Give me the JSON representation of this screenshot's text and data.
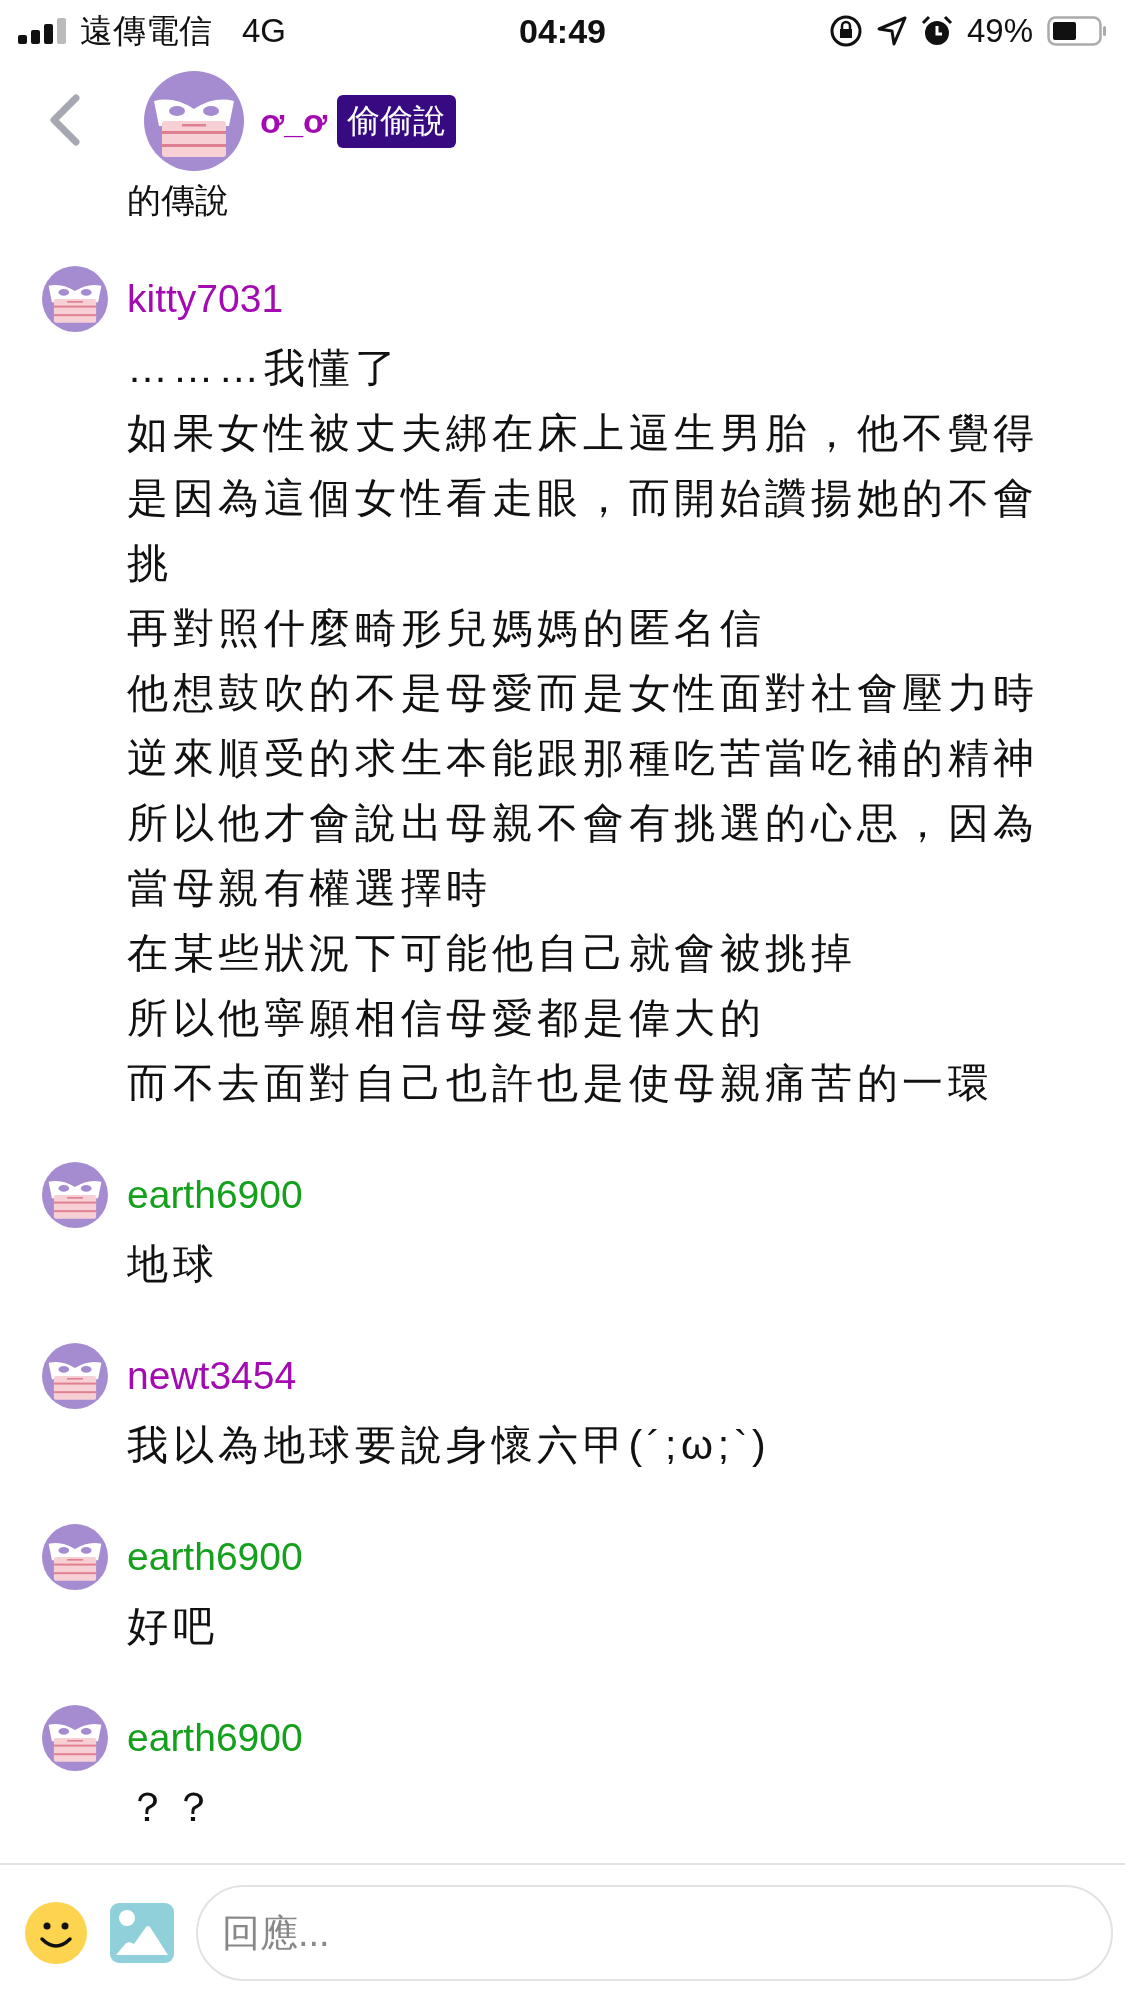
{
  "status_bar": {
    "carrier": "遠傳電信",
    "network": "4G",
    "time": "04:49",
    "battery": "49%"
  },
  "header": {
    "name": "ơ_ơ",
    "badge": "偷偷說"
  },
  "partial_text": "的傳說",
  "comments": [
    {
      "user": "kitty7031",
      "color": "#a40ab2",
      "lines": [
        "………我懂了",
        "如果女性被丈夫綁在床上逼生男胎，他不覺得",
        "是因為這個女性看走眼，而開始讚揚她的不會",
        "挑",
        "再對照什麼畸形兒媽媽的匿名信",
        "他想鼓吹的不是母愛而是女性面對社會壓力時",
        "逆來順受的求生本能跟那種吃苦當吃補的精神",
        "所以他才會說出母親不會有挑選的心思，因為",
        "當母親有權選擇時",
        "在某些狀況下可能他自己就會被挑掉",
        "所以他寧願相信母愛都是偉大的",
        "而不去面對自己也許也是使母親痛苦的一環"
      ]
    },
    {
      "user": "earth6900",
      "color": "#14a01c",
      "lines": [
        "地球"
      ]
    },
    {
      "user": "newt3454",
      "color": "#a40ab2",
      "lines": [
        "我以為地球要說身懷六甲(´;ω;`)"
      ]
    },
    {
      "user": "earth6900",
      "color": "#14a01c",
      "lines": [
        "好吧"
      ]
    },
    {
      "user": "earth6900",
      "color": "#14a01c",
      "lines": [
        "？？"
      ]
    }
  ],
  "reply": {
    "placeholder": "回應..."
  }
}
